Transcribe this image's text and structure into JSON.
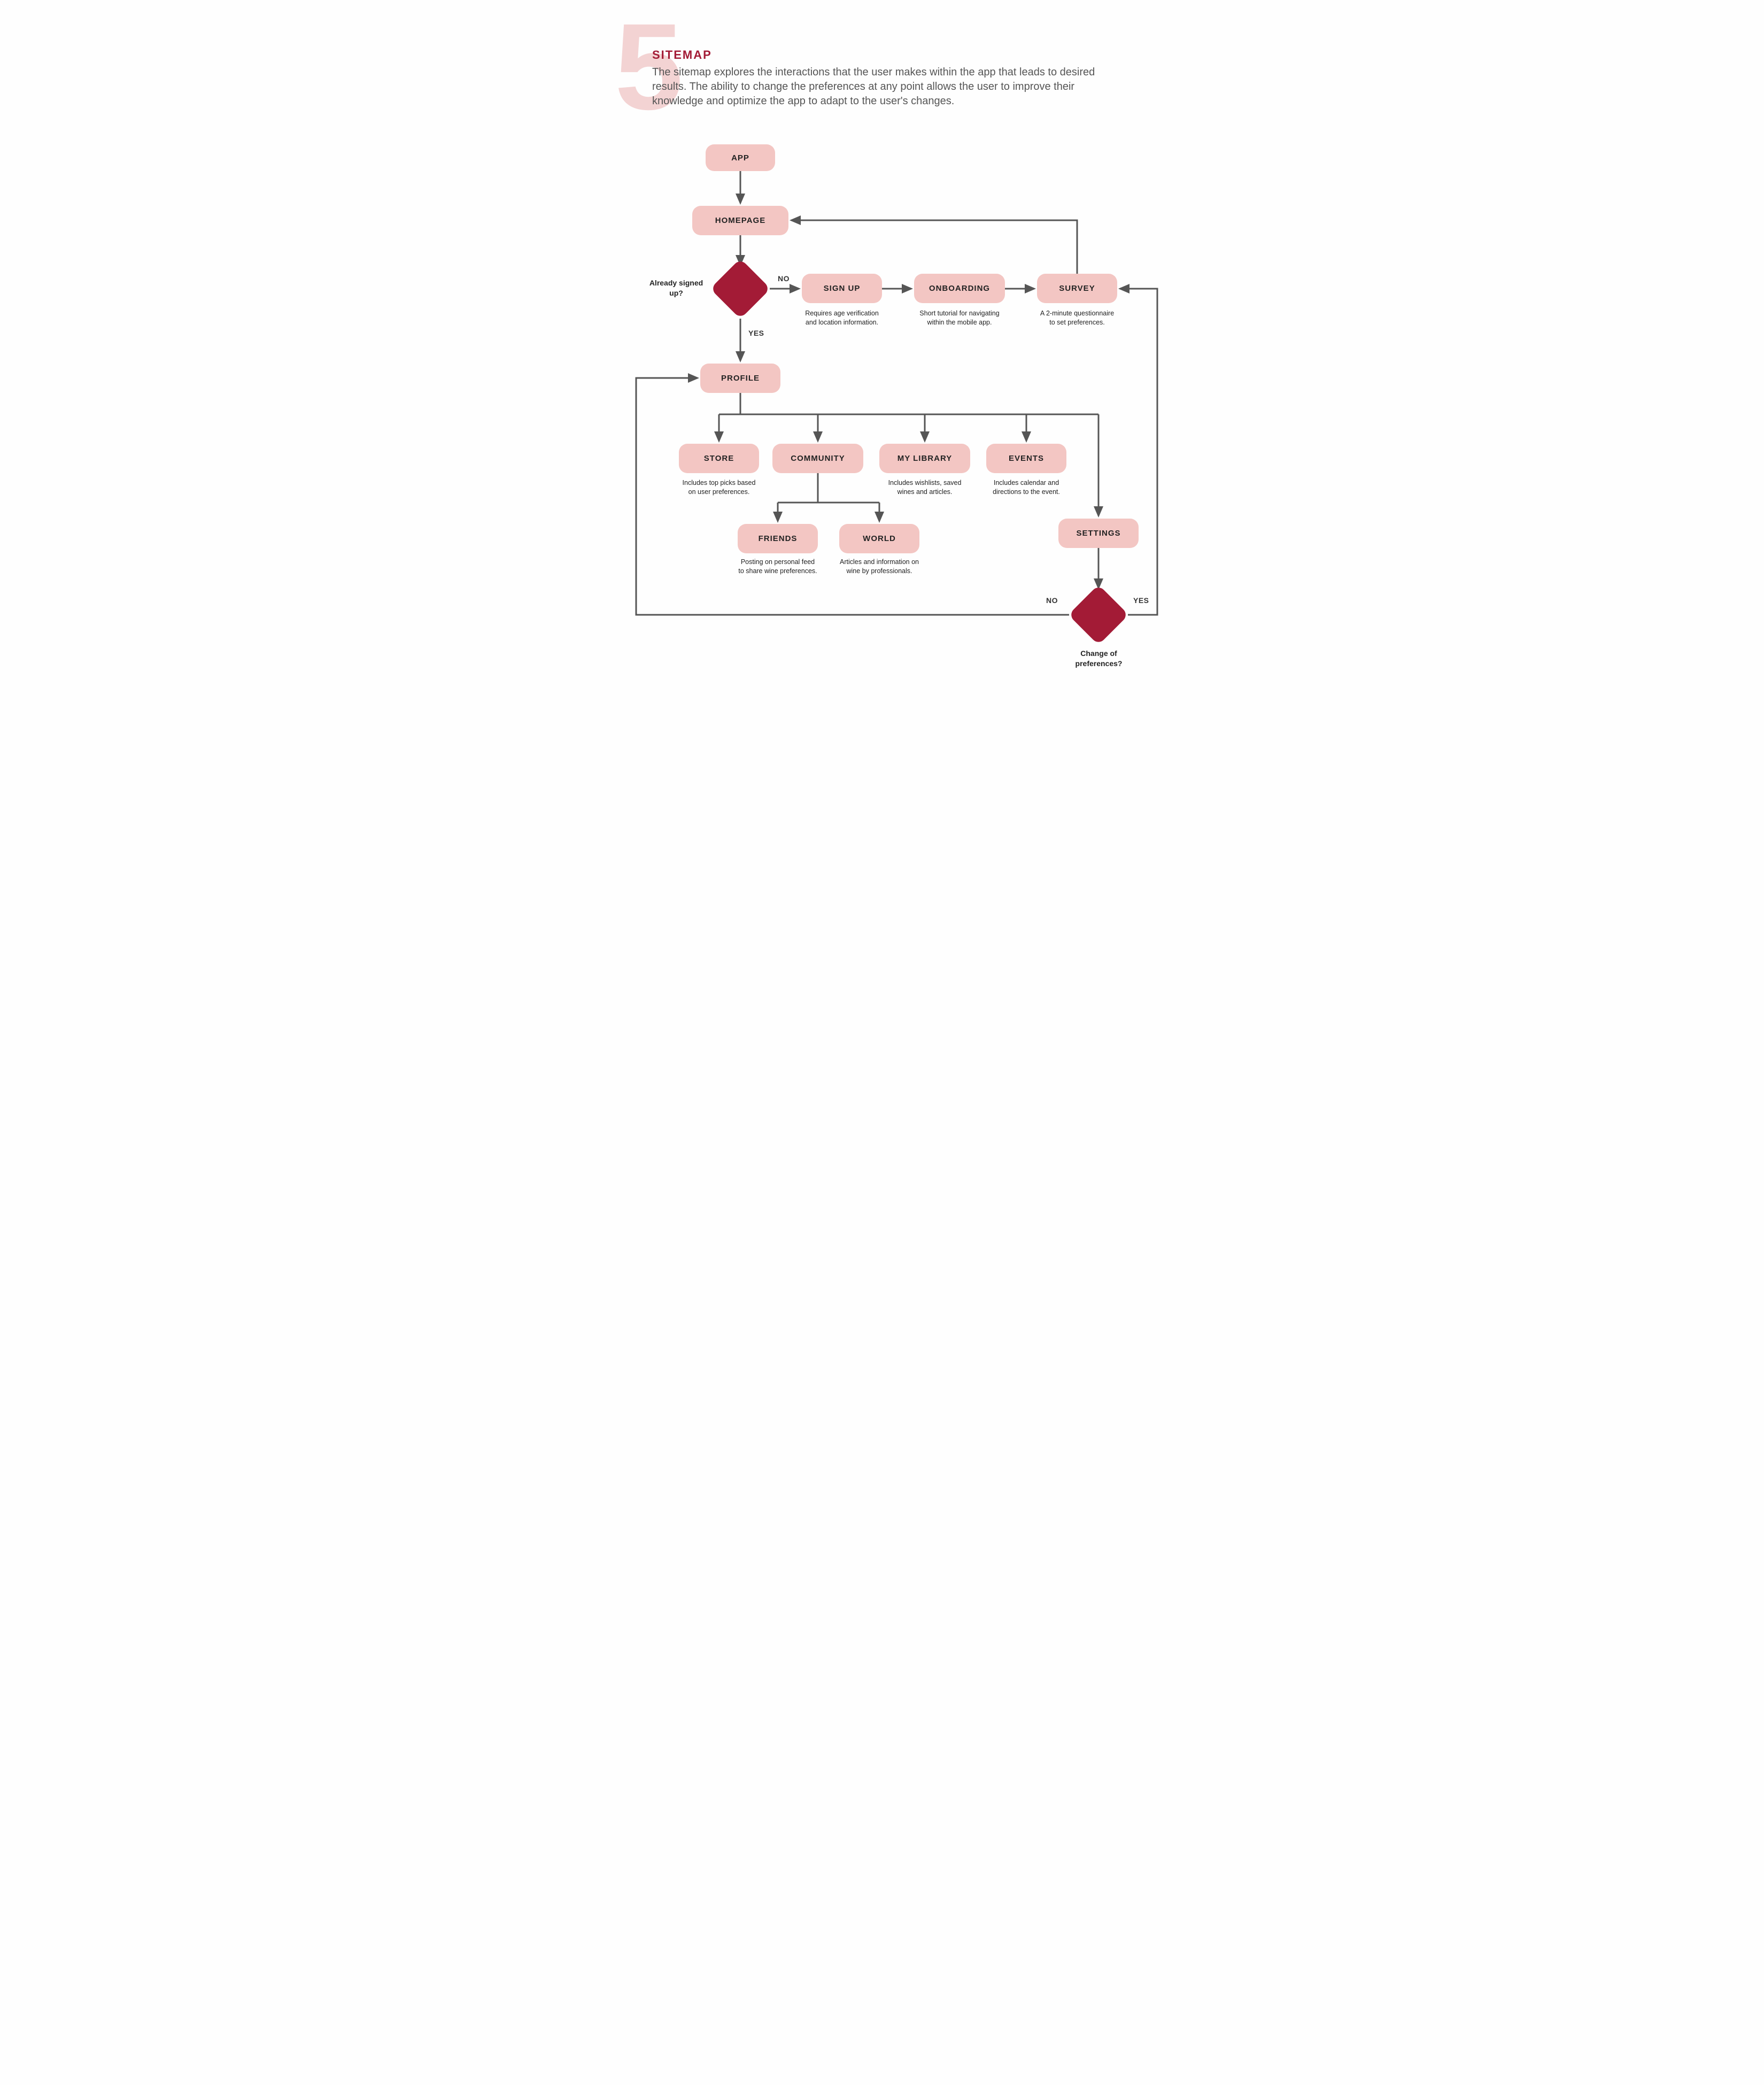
{
  "section_number": "5",
  "section_title": "SITEMAP",
  "section_desc": "The sitemap explores the interactions that the user makes within the app that leads to desired results. The ability to change the preferences at any point allows the user to improve their knowledge and optimize the app to adapt to the user's changes.",
  "nodes": {
    "app": "APP",
    "homepage": "HOMEPAGE",
    "signup": "SIGN UP",
    "onboarding": "ONBOARDING",
    "survey": "SURVEY",
    "profile": "PROFILE",
    "store": "STORE",
    "community": "COMMUNITY",
    "mylibrary": "MY LIBRARY",
    "events": "EVENTS",
    "friends": "FRIENDS",
    "world": "WORLD",
    "settings": "SETTINGS"
  },
  "captions": {
    "signup": "Requires age verification and location information.",
    "onboarding": "Short tutorial for navigating within the mobile app.",
    "survey": "A 2-minute questionnaire to set preferences.",
    "store": "Includes top picks based on user preferences.",
    "mylibrary": "Includes wishlists, saved wines and articles.",
    "events": "Includes calendar and directions to the event.",
    "friends": "Posting on personal feed to share wine preferences.",
    "world": "Articles and information on wine by professionals."
  },
  "decisions": {
    "signed_up": "Already signed up?",
    "change_pref": "Change of preferences?"
  },
  "labels": {
    "yes": "YES",
    "no": "NO"
  }
}
